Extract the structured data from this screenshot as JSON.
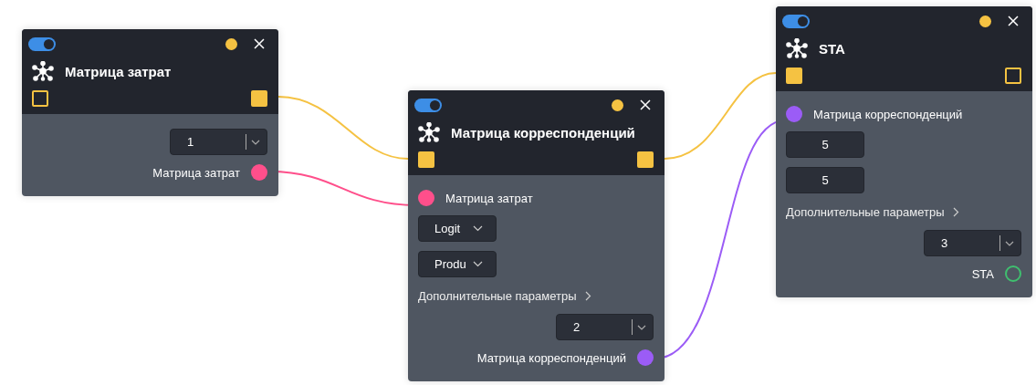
{
  "nodes": [
    {
      "title": "Матрица затрат",
      "enabled": true,
      "color": "#f5c242",
      "flow_in_connected": false,
      "flow_out_connected": true,
      "rows": [
        {
          "kind": "number-select",
          "value": "1"
        },
        {
          "kind": "output",
          "label": "Матрица затрат",
          "color": "#ff4f8b",
          "connected": true
        }
      ]
    },
    {
      "title": "Матрица корреспонденций",
      "enabled": true,
      "color": "#f5c242",
      "flow_in_connected": true,
      "flow_out_connected": true,
      "rows": [
        {
          "kind": "input",
          "label": "Матрица затрат",
          "color": "#ff4f8b",
          "connected": true
        },
        {
          "kind": "select",
          "value": "Logit"
        },
        {
          "kind": "select",
          "value": "Produ"
        },
        {
          "kind": "expander",
          "label": "Дополнительные параметры",
          "expanded": false
        },
        {
          "kind": "number-select",
          "value": "2"
        },
        {
          "kind": "output",
          "label": "Матрица корреспонденций",
          "color": "#9b5cf6",
          "connected": true
        }
      ]
    },
    {
      "title": "STA",
      "enabled": true,
      "color": "#f5c242",
      "flow_in_connected": true,
      "flow_out_connected": false,
      "rows": [
        {
          "kind": "input",
          "label": "Матрица корреспонденций",
          "color": "#9b5cf6",
          "connected": true
        },
        {
          "kind": "number",
          "value": "5"
        },
        {
          "kind": "number",
          "value": "5"
        },
        {
          "kind": "expander",
          "label": "Дополнительные параметры",
          "expanded": false
        },
        {
          "kind": "number-select",
          "value": "3"
        },
        {
          "kind": "output",
          "label": "STA",
          "color": "#3fbf6f",
          "connected": false
        }
      ]
    }
  ]
}
